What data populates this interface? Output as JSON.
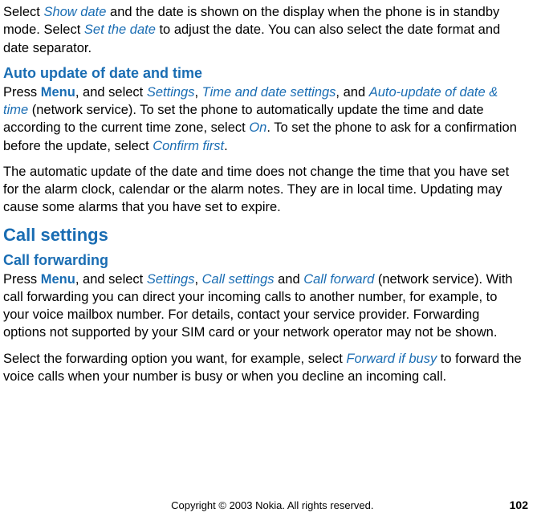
{
  "para1": {
    "t1": "Select ",
    "showDate": "Show date",
    "t2": " and the date is shown on the display when the phone is in standby mode. Select ",
    "setTheDate": "Set the date",
    "t3": " to adjust the date. You can also select the date format and date separator."
  },
  "sec1Heading": "Auto update of date and time",
  "para2": {
    "t1": "Press ",
    "menu": "Menu",
    "t2": ", and select ",
    "settings": "Settings",
    "t3": ", ",
    "timeDate": "Time and date settings",
    "t4": ", and ",
    "autoUpdate": "Auto-update of date & time",
    "t5": " (network service). To set the phone to automatically update the time and date according to the current time zone, select ",
    "on": "On",
    "t6": ". To set the phone to ask for a confirmation before the update, select ",
    "confirmFirst": "Confirm first",
    "t7": "."
  },
  "para3": "The automatic update of the date and time does not change the time that you have set for the alarm clock, calendar or the alarm notes. They are in local time. Updating may cause some alarms that you have set to expire.",
  "sec2Heading": "Call settings",
  "sec2SubHeading": "Call forwarding",
  "para4": {
    "t1": "Press ",
    "menu": "Menu",
    "t2": ", and select ",
    "settings": "Settings",
    "t3": ", ",
    "callSettings": "Call settings",
    "t4": " and ",
    "callForward": "Call forward",
    "t5": " (network service). With call forwarding you can direct your incoming calls to another number, for example, to your voice mailbox number. For details, contact your service provider. Forwarding options not supported by your SIM card or your network operator may not be shown."
  },
  "para5": {
    "t1": "Select the forwarding option you want, for example, select ",
    "forwardIfBusy": "Forward if busy",
    "t2": " to forward the voice calls when your number is busy or when you decline an incoming call."
  },
  "footer": {
    "copyright": "Copyright © 2003 Nokia. All rights reserved.",
    "page": "102"
  }
}
